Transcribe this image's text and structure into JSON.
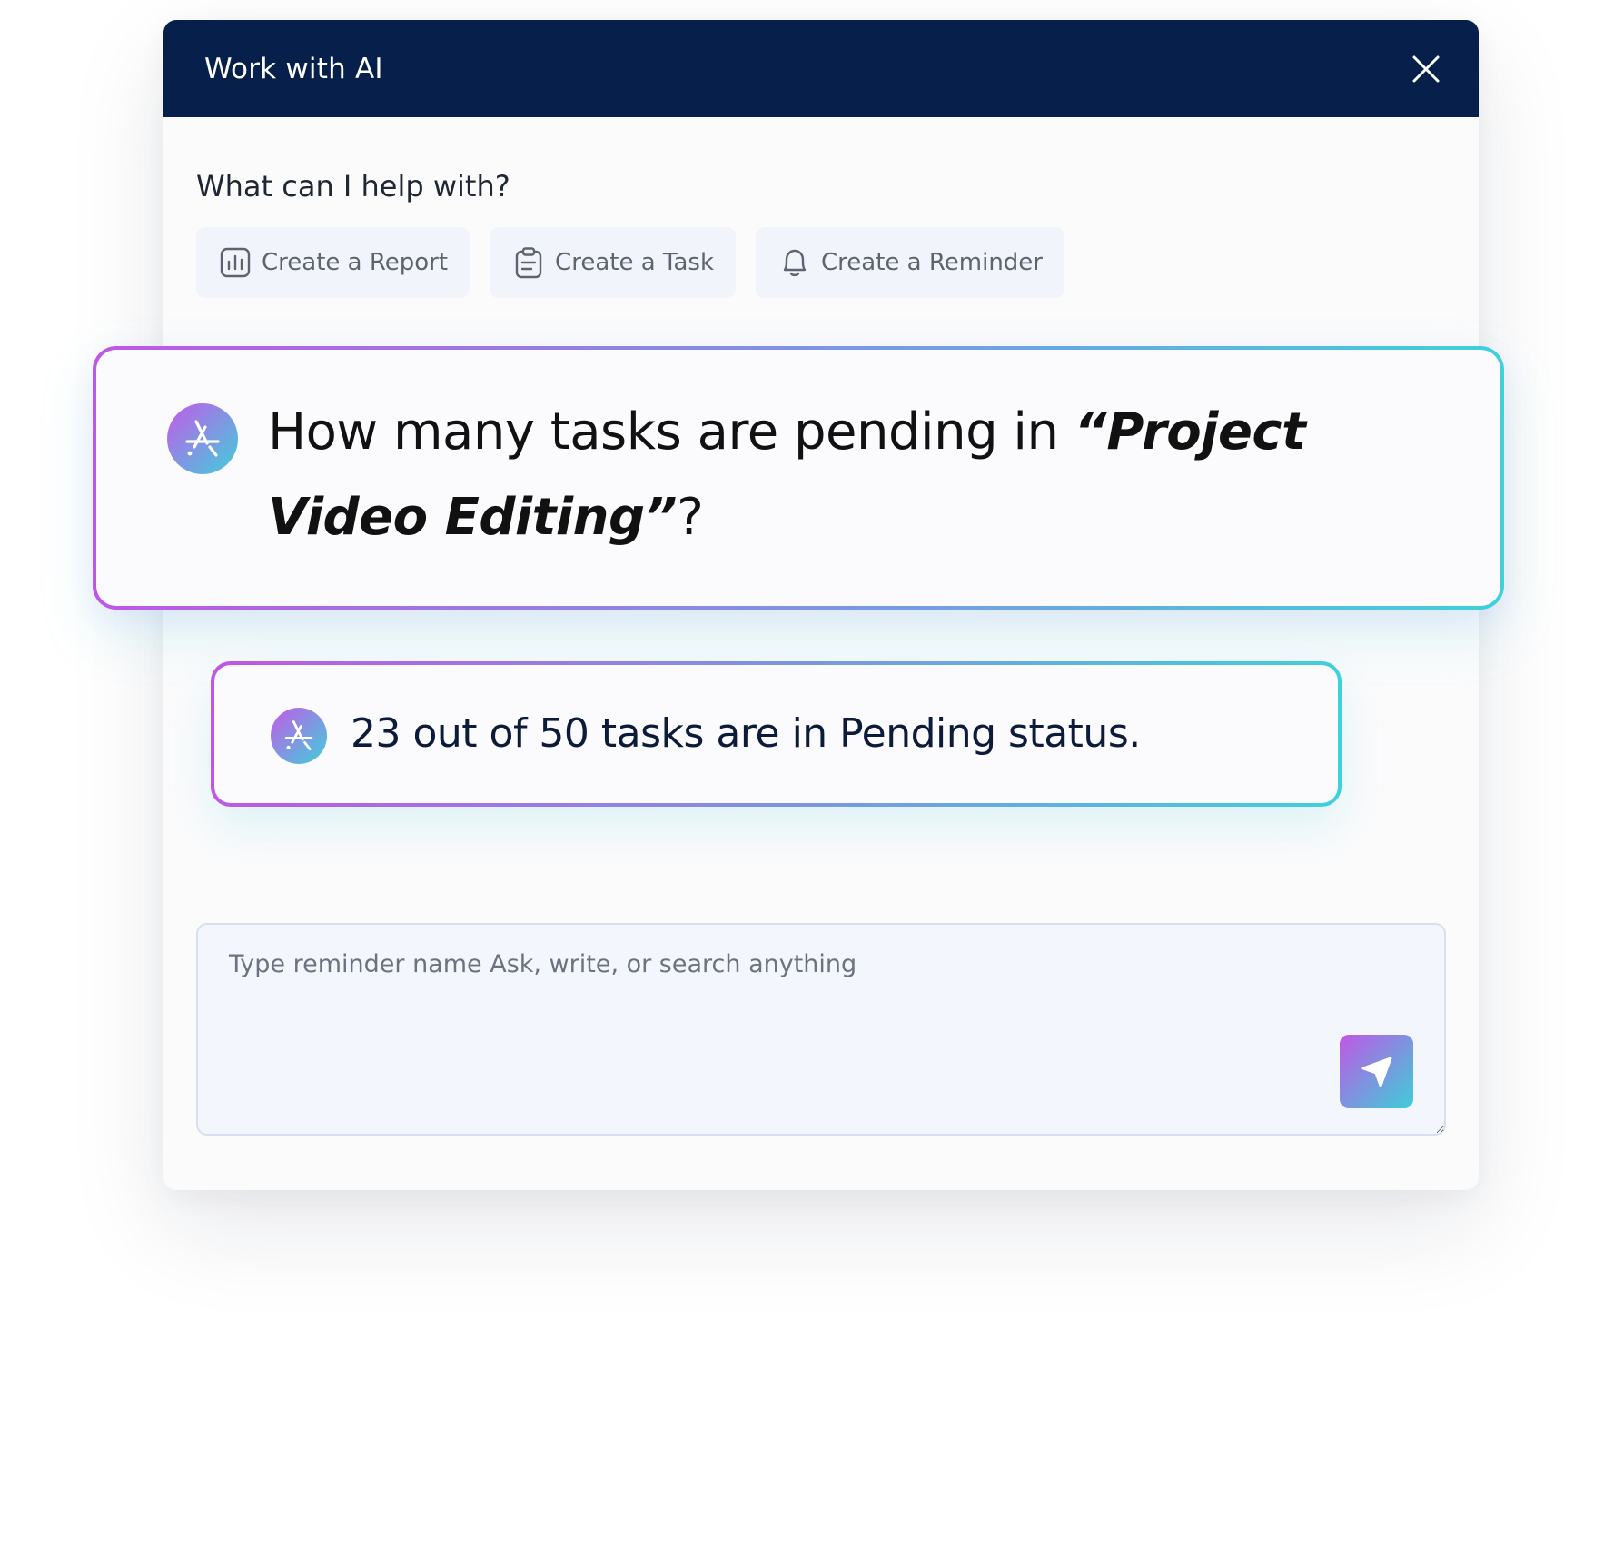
{
  "dialog": {
    "title": "Work with AI",
    "close_icon": "close-icon"
  },
  "help": {
    "heading": "What can I help with?",
    "chips": [
      {
        "label": "Create a Report",
        "icon": "bar-chart-icon"
      },
      {
        "label": "Create a Task",
        "icon": "clipboard-icon"
      },
      {
        "label": "Create a Reminder",
        "icon": "bell-icon"
      }
    ]
  },
  "conversation": {
    "question": {
      "prefix": "How many tasks are pending in ",
      "emphasis": "“Project Video Editing”",
      "suffix": "?"
    },
    "answer": "23 out of 50 tasks are in Pending status."
  },
  "composer": {
    "placeholder": "Type reminder name Ask, write, or search anything",
    "value": "",
    "send_icon": "send-icon"
  },
  "colors": {
    "header_bg": "#06204b",
    "gradient_start": "#c057e5",
    "gradient_end": "#3ccfd9",
    "chip_bg": "#f1f4fa",
    "composer_bg": "#f3f6fc"
  }
}
